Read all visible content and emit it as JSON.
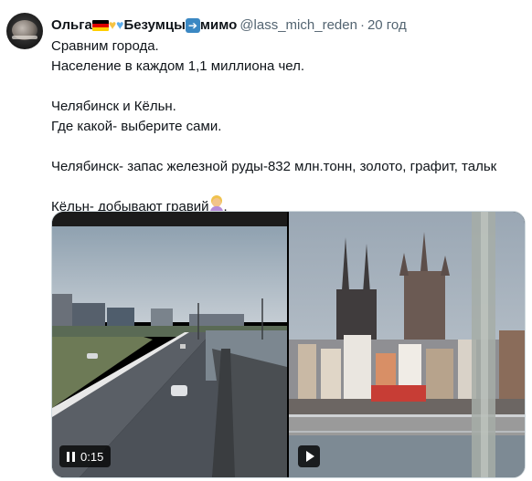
{
  "tweet": {
    "author_name": "Ольга",
    "author_name_suffix": "Безумцы",
    "author_name_end": "мимо",
    "handle": "@lass_mich_reden",
    "separator": "·",
    "time": "20 год",
    "lines": [
      "Сравним города.",
      "Население в каждом 1,1 миллиона чел.",
      "",
      "Челябинск и Кёльн.",
      "Где какой- выберите сами.",
      "",
      "Челябинск- запас железной руды-832 млн.тонн, золото, графит, тальк",
      "",
      "Кёльн- добывают гравий"
    ],
    "last_line_end": "."
  },
  "media": {
    "left_video": {
      "duration": "0:15",
      "control": "pause-icon"
    },
    "right_video": {
      "control": "play-icon"
    }
  },
  "colors": {
    "text": "#0f1419",
    "secondary": "#536471",
    "border": "#cfd9de"
  }
}
